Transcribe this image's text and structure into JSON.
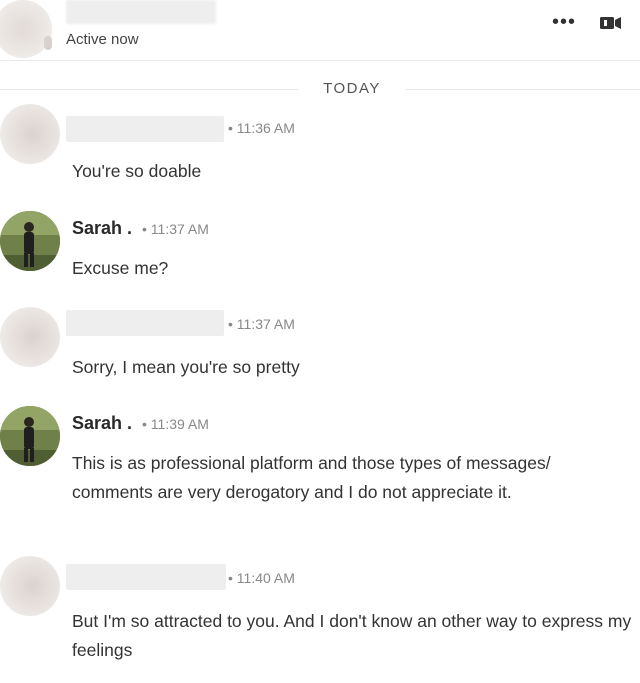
{
  "header": {
    "status": "Active now",
    "more_glyph": "•••",
    "icons": [
      "more-icon",
      "video-icon"
    ]
  },
  "divider": {
    "date": "TODAY"
  },
  "messages": [
    {
      "sender": "",
      "time": "• 11:36 AM",
      "text": "You're so doable"
    },
    {
      "sender": "Sarah .",
      "time": "• 11:37 AM",
      "text": "Excuse me?"
    },
    {
      "sender": "",
      "time": "• 11:37 AM",
      "text": "Sorry, I mean you're so pretty"
    },
    {
      "sender": "Sarah .",
      "time": "• 11:39 AM",
      "text": "This is as professional platform and those types of messages/ comments are very derogatory and I do not appreciate it."
    },
    {
      "sender": "",
      "time": "• 11:40 AM",
      "text": "But I'm so attracted to you. And I don't know an other way to express my feelings"
    }
  ]
}
